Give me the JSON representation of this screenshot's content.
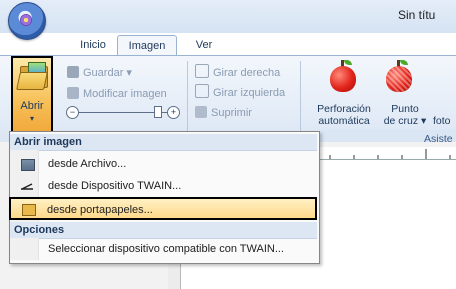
{
  "window": {
    "title": "Sin títu"
  },
  "tabs": [
    {
      "label": "Inicio"
    },
    {
      "label": "Imagen"
    },
    {
      "label": "Ver"
    }
  ],
  "ribbon": {
    "abrir": {
      "label": "Abrir",
      "arrow": "▾"
    },
    "guardar": {
      "label": "Guardar ▾"
    },
    "modificar": {
      "label": "Modificar imagen"
    },
    "girar_derecha": {
      "label": "Girar derecha"
    },
    "girar_izquierda": {
      "label": "Girar izquierda"
    },
    "suprimir": {
      "label": "Suprimir"
    },
    "perforacion": {
      "label_line1": "Perforación",
      "label_line2": "automática"
    },
    "punto_cruz": {
      "label_line1": "Punto",
      "label_line2": "de cruz ▾"
    },
    "foto": {
      "label": "foto"
    },
    "group_label": "Asiste",
    "zoom_minus": "−",
    "zoom_plus": "+"
  },
  "menu": {
    "header_open": "Abrir imagen",
    "items": [
      {
        "label": "desde Archivo...",
        "icon": "folder-icon"
      },
      {
        "label": "desde Dispositivo TWAIN...",
        "icon": "twain-scanner-icon"
      },
      {
        "label": "desde portapapeles...",
        "icon": "clipboard-icon",
        "highlighted": true
      }
    ],
    "header_options": "Opciones",
    "options_items": [
      {
        "label": "Seleccionar dispositivo compatible con TWAIN..."
      }
    ]
  },
  "colors": {
    "accent_highlight": "#f7c35c",
    "ribbon_bg": "#dbe6f4",
    "text": "#1e395b"
  }
}
